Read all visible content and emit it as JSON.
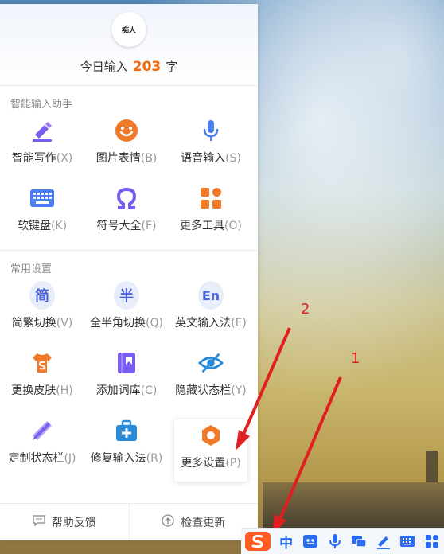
{
  "header": {
    "avatar_text": "痴人",
    "count_prefix": "今日输入",
    "count_value": "203",
    "count_suffix": "字"
  },
  "section1": {
    "title": "智能输入助手",
    "items": [
      {
        "label": "智能写作",
        "key": "(X)",
        "icon": "pen-icon"
      },
      {
        "label": "图片表情",
        "key": "(B)",
        "icon": "smiley-icon"
      },
      {
        "label": "语音输入",
        "key": "(S)",
        "icon": "microphone-icon"
      },
      {
        "label": "软键盘",
        "key": "(K)",
        "icon": "keyboard-icon"
      },
      {
        "label": "符号大全",
        "key": "(F)",
        "icon": "omega-icon"
      },
      {
        "label": "更多工具",
        "key": "(O)",
        "icon": "tools-icon"
      }
    ]
  },
  "section2": {
    "title": "常用设置",
    "items": [
      {
        "label": "简繁切换",
        "key": "(V)",
        "glyph": "简"
      },
      {
        "label": "全半角切换",
        "key": "(Q)",
        "glyph": "半"
      },
      {
        "label": "英文输入法",
        "key": "(E)",
        "glyph": "En"
      },
      {
        "label": "更换皮肤",
        "key": "(H)",
        "icon": "tshirt-icon"
      },
      {
        "label": "添加词库",
        "key": "(C)",
        "icon": "book-icon"
      },
      {
        "label": "隐藏状态栏",
        "key": "(Y)",
        "icon": "eye-hidden-icon"
      },
      {
        "label": "定制状态栏",
        "key": "(J)",
        "icon": "ruler-pencil-icon"
      },
      {
        "label": "修复输入法",
        "key": "(R)",
        "icon": "medkit-icon"
      },
      {
        "label": "更多设置",
        "key": "(P)",
        "icon": "hexagon-gear-icon"
      }
    ]
  },
  "footer": {
    "feedback": "帮助反馈",
    "update": "检查更新"
  },
  "taskbar": {
    "lang": "中"
  },
  "annotations": [
    "2",
    "1"
  ],
  "colors": {
    "accent": "#f06a0d",
    "purple": "#7a5cf0",
    "blue": "#4a64d8",
    "orange": "#f07a2a"
  }
}
